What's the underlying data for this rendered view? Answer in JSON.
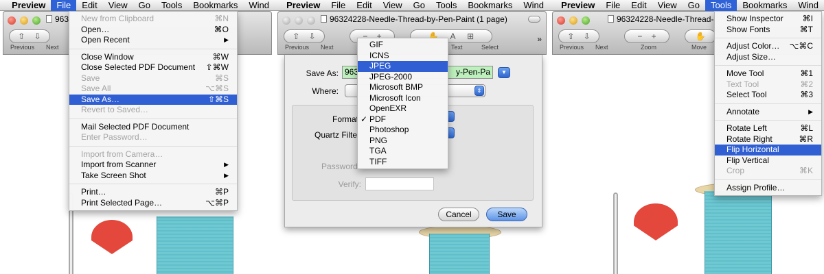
{
  "menubar": {
    "app": "Preview",
    "items": [
      "File",
      "Edit",
      "View",
      "Go",
      "Tools",
      "Bookmarks",
      "Wind"
    ]
  },
  "panel1": {
    "window_title": "963",
    "toolbar": {
      "previous": "Previous",
      "next": "Next"
    },
    "file_menu": [
      {
        "label": "New from Clipboard",
        "shortcut": "⌘N",
        "disabled": true
      },
      {
        "label": "Open…",
        "shortcut": "⌘O"
      },
      {
        "label": "Open Recent",
        "submenu": true
      },
      {
        "separator": true
      },
      {
        "label": "Close Window",
        "shortcut": "⌘W"
      },
      {
        "label": "Close Selected PDF Document",
        "shortcut": "⇧⌘W"
      },
      {
        "label": "Save",
        "shortcut": "⌘S",
        "disabled": true
      },
      {
        "label": "Save All",
        "shortcut": "⌥⌘S",
        "disabled": true
      },
      {
        "label": "Save As…",
        "shortcut": "⇧⌘S",
        "highlighted": true
      },
      {
        "label": "Revert to Saved…",
        "disabled": true
      },
      {
        "separator": true
      },
      {
        "label": "Mail Selected PDF Document"
      },
      {
        "label": "Enter Password…",
        "disabled": true
      },
      {
        "separator": true
      },
      {
        "label": "Import from Camera…",
        "disabled": true
      },
      {
        "label": "Import from Scanner",
        "submenu": true
      },
      {
        "label": "Take Screen Shot",
        "submenu": true
      },
      {
        "separator": true
      },
      {
        "label": "Print…",
        "shortcut": "⌘P"
      },
      {
        "label": "Print Selected Page…",
        "shortcut": "⌥⌘P"
      }
    ]
  },
  "panel2": {
    "window_title": "96324228-Needle-Thread-by-Pen-Paint (1 page)",
    "toolbar": {
      "previous": "Previous",
      "next": "Next",
      "text": "Text",
      "select": "Select"
    },
    "dialog": {
      "save_as_label": "Save As:",
      "save_as_value_left": "963",
      "save_as_value_right": "y-Pen-Pa",
      "where_label": "Where:",
      "format_label": "Format",
      "quartz_label": "Quartz Filter",
      "password_label": "Password:",
      "verify_label": "Verify:",
      "cancel": "Cancel",
      "save": "Save"
    },
    "format_menu": [
      {
        "label": "GIF"
      },
      {
        "label": "ICNS"
      },
      {
        "label": "JPEG",
        "highlighted": true
      },
      {
        "label": "JPEG-2000"
      },
      {
        "label": "Microsoft BMP"
      },
      {
        "label": "Microsoft Icon"
      },
      {
        "label": "OpenEXR"
      },
      {
        "label": "PDF",
        "checked": true
      },
      {
        "label": "Photoshop"
      },
      {
        "label": "PNG"
      },
      {
        "label": "TGA"
      },
      {
        "label": "TIFF"
      }
    ]
  },
  "panel3": {
    "window_title": "96324228-Needle-Thread-",
    "toolbar": {
      "previous": "Previous",
      "next": "Next",
      "zoom": "Zoom",
      "move": "Move"
    },
    "tools_menu": [
      {
        "label": "Show Inspector",
        "shortcut": "⌘I"
      },
      {
        "label": "Show Fonts",
        "shortcut": "⌘T"
      },
      {
        "separator": true
      },
      {
        "label": "Adjust Color…",
        "shortcut": "⌥⌘C"
      },
      {
        "label": "Adjust Size…"
      },
      {
        "separator": true
      },
      {
        "label": "Move Tool",
        "shortcut": "⌘1"
      },
      {
        "label": "Text Tool",
        "shortcut": "⌘2",
        "disabled": true
      },
      {
        "label": "Select Tool",
        "shortcut": "⌘3"
      },
      {
        "separator": true
      },
      {
        "label": "Annotate",
        "submenu": true
      },
      {
        "separator": true
      },
      {
        "label": "Rotate Left",
        "shortcut": "⌘L"
      },
      {
        "label": "Rotate Right",
        "shortcut": "⌘R"
      },
      {
        "label": "Flip Horizontal",
        "highlighted": true
      },
      {
        "label": "Flip Vertical"
      },
      {
        "label": "Crop",
        "shortcut": "⌘K",
        "disabled": true
      },
      {
        "separator": true
      },
      {
        "label": "Assign Profile…"
      }
    ]
  }
}
